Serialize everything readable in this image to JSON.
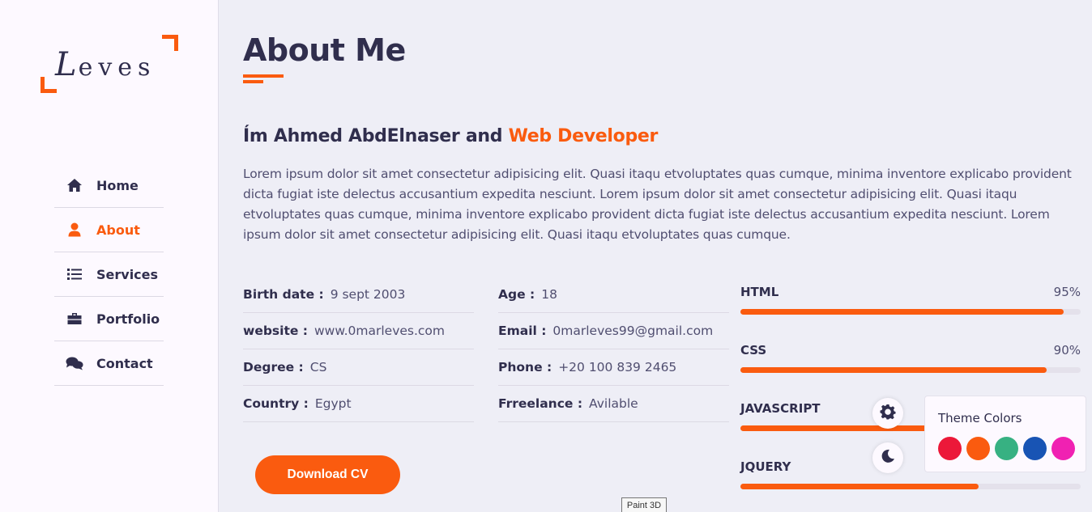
{
  "logo": {
    "first_letter": "L",
    "rest": "eves"
  },
  "nav": {
    "items": [
      {
        "label": "Home",
        "icon": "home-icon",
        "active": false
      },
      {
        "label": "About",
        "icon": "user-icon",
        "active": true
      },
      {
        "label": "Services",
        "icon": "list-icon",
        "active": false
      },
      {
        "label": "Portfolio",
        "icon": "briefcase-icon",
        "active": false
      },
      {
        "label": "Contact",
        "icon": "comments-icon",
        "active": false
      }
    ]
  },
  "main": {
    "title": "About Me",
    "headline_prefix": "Ím Ahmed AbdElnaser and ",
    "headline_accent": "Web Developer",
    "bio": "Lorem ipsum dolor sit amet consectetur adipisicing elit. Quasi itaqu etvoluptates quas cumque, minima inventore explicabo provident dicta fugiat iste delectus accusantium expedita nesciunt. Lorem ipsum dolor sit amet consectetur adipisicing elit. Quasi itaqu etvoluptates quas cumque, minima inventore explicabo provident dicta fugiat iste delectus accusantium expedita nesciunt. Lorem ipsum dolor sit amet consectetur adipisicing elit. Quasi itaqu etvoluptates quas cumque.",
    "info_left": [
      {
        "label": "Birth date :",
        "value": "9 sept 2003"
      },
      {
        "label": "website :",
        "value": "www.0marleves.com"
      },
      {
        "label": "Degree :",
        "value": "CS"
      },
      {
        "label": "Country :",
        "value": "Egypt"
      }
    ],
    "info_right": [
      {
        "label": "Age :",
        "value": "18"
      },
      {
        "label": "Email :",
        "value": "0marleves99@gmail.com"
      },
      {
        "label": "Phone :",
        "value": "+20 100 839 2465"
      },
      {
        "label": "Frreelance :",
        "value": "Avilable"
      }
    ],
    "download_label": "Download CV",
    "skills": [
      {
        "name": "HTML",
        "percent": 95,
        "percent_label": "95%"
      },
      {
        "name": "CSS",
        "percent": 90,
        "percent_label": "90%"
      },
      {
        "name": "JAVASCRIPT",
        "percent": 86,
        "percent_label": ""
      },
      {
        "name": "JQUERY",
        "percent": 70,
        "percent_label": ""
      }
    ]
  },
  "theme_panel": {
    "title": "Theme Colors",
    "colors": [
      "#ec1839",
      "#fa5b0f",
      "#37b182",
      "#1854b4",
      "#f021b2"
    ]
  },
  "tooltip": {
    "text": "Paint 3D"
  },
  "colors": {
    "accent": "#fa5b0f",
    "text": "#302e4d",
    "background": "#eeeef6"
  }
}
